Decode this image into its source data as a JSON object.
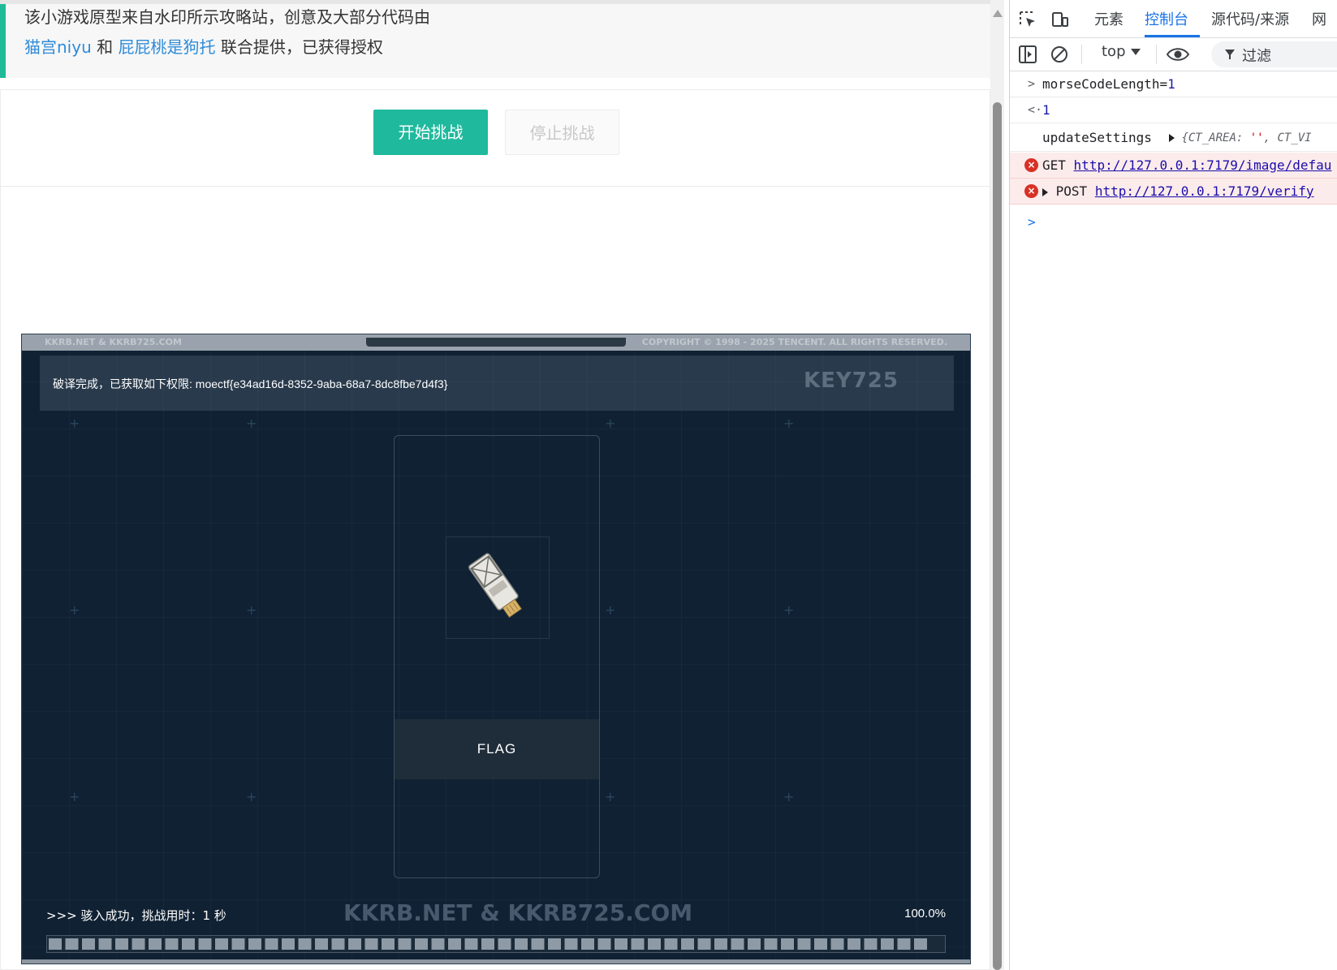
{
  "notice": {
    "line1": "该小游戏原型来自水印所示攻略站，创意及大部分代码由",
    "link1": "猫宫niyu",
    "mid": " 和 ",
    "link2": "屁屁桃是狗托",
    "tail": " 联合提供，已获得授权"
  },
  "buttons": {
    "start": "开始挑战",
    "stop": "停止挑战"
  },
  "game": {
    "top_left": "KKRB.NET & KKRB725.COM",
    "top_right": "COPYRIGHT © 1998 - 2025 TENCENT. ALL RIGHTS RESERVED.",
    "result": "破译完成，已获取如下权限: moectf{e34ad16d-8352-9aba-68a7-8dc8fbe7d4f3}",
    "result_logo": "KEY725",
    "item_label": "FLAG",
    "item_icon": "usb-key-icon",
    "status": ">>> 骇入成功，挑战用时：1 秒",
    "watermark": "KKRB.NET & KKRB725.COM",
    "percent": "100.0%",
    "progress": 1.0,
    "accent": "#1fb99d"
  },
  "devtools": {
    "tabs": [
      "元素",
      "控制台",
      "源代码/来源",
      "网"
    ],
    "active_tab": "控制台",
    "context": "top",
    "filter": "过滤",
    "console": {
      "input1": "morseCodeLength=",
      "input1_value": "1",
      "output1": "1",
      "log_label": "updateSettings",
      "log_obj_key1": "CT_AREA",
      "log_obj_val1": "''",
      "log_obj_key2": "CT_VI",
      "err1_method": "GET",
      "err1_url": "http://127.0.0.1:7179/image/defau",
      "err2_method": "POST",
      "err2_url": "http://127.0.0.1:7179/verify"
    }
  }
}
